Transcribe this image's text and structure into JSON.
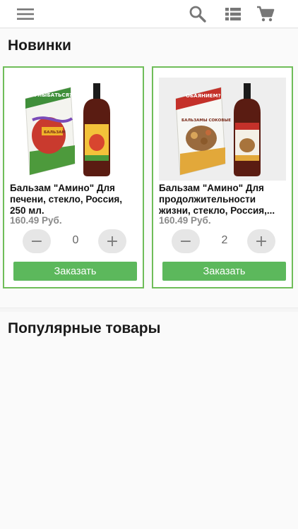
{
  "topbar": {
    "menu_icon": "hamburger-menu-icon",
    "search_icon": "search-icon",
    "catalog_icon": "list-view-icon",
    "cart_icon": "shopping-cart-icon"
  },
  "new_section": {
    "title": "Новинки",
    "products": [
      {
        "name": "Бальзам \"Амино\" Для печени, стекло, Россия, 250 мл.",
        "price": "160.49 Руб.",
        "quantity": "0",
        "minus": "−",
        "plus": "+",
        "order_label": "Заказать",
        "box_text": "УЛЫБАТЬСЯ?",
        "box_label": "БАЛЬЗАМ"
      },
      {
        "name": "Бальзам \"Амино\" Для продолжительности жизни, стекло, Россия,...",
        "price": "160.49 Руб.",
        "quantity": "2",
        "minus": "−",
        "plus": "+",
        "order_label": "Заказать",
        "box_text": "ОБАЯНИЕМ?",
        "box_label": "БАЛЬЗАМЫ СОКОВЫЕ"
      }
    ],
    "carousel_pages": 3,
    "carousel_active": 1
  },
  "popular_section": {
    "title": "Популярные товары"
  },
  "colors": {
    "accent_green": "#5cb85c",
    "card_border": "#6fbd59",
    "dot_active": "#3b7de0"
  }
}
